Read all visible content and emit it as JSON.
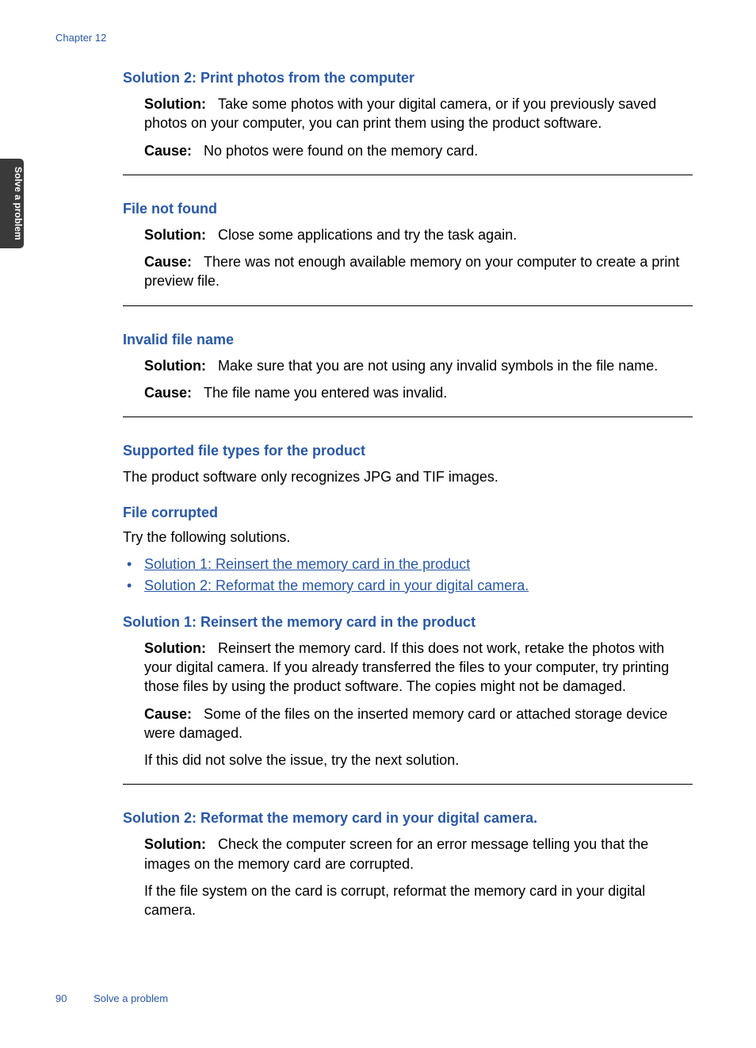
{
  "chapter": "Chapter 12",
  "sideTab": "Solve a problem",
  "sections": {
    "sol2print": {
      "heading": "Solution 2: Print photos from the computer",
      "solutionLabel": "Solution:",
      "solutionText": "Take some photos with your digital camera, or if you previously saved photos on your computer, you can print them using the product software.",
      "causeLabel": "Cause:",
      "causeText": "No photos were found on the memory card."
    },
    "fileNotFound": {
      "heading": "File not found",
      "solutionLabel": "Solution:",
      "solutionText": "Close some applications and try the task again.",
      "causeLabel": "Cause:",
      "causeText": "There was not enough available memory on your computer to create a print preview file."
    },
    "invalidFileName": {
      "heading": "Invalid file name",
      "solutionLabel": "Solution:",
      "solutionText": "Make sure that you are not using any invalid symbols in the file name.",
      "causeLabel": "Cause:",
      "causeText": "The file name you entered was invalid."
    },
    "supportedTypes": {
      "heading": "Supported file types for the product",
      "text": "The product software only recognizes JPG and TIF images."
    },
    "fileCorrupted": {
      "heading": "File corrupted",
      "tryText": "Try the following solutions.",
      "link1": "Solution 1: Reinsert the memory card in the product",
      "link2": "Solution 2: Reformat the memory card in your digital camera."
    },
    "sol1reinsert": {
      "heading": "Solution 1: Reinsert the memory card in the product",
      "solutionLabel": "Solution:",
      "solutionText": "Reinsert the memory card. If this does not work, retake the photos with your digital camera. If you already transferred the files to your computer, try printing those files by using the product software. The copies might not be damaged.",
      "causeLabel": "Cause:",
      "causeText": "Some of the files on the inserted memory card or attached storage device were damaged.",
      "nextText": "If this did not solve the issue, try the next solution."
    },
    "sol2reformat": {
      "heading": "Solution 2: Reformat the memory card in your digital camera.",
      "solutionLabel": "Solution:",
      "solutionText": "Check the computer screen for an error message telling you that the images on the memory card are corrupted.",
      "extraText": "If the file system on the card is corrupt, reformat the memory card in your digital camera."
    }
  },
  "footer": {
    "pageNum": "90",
    "text": "Solve a problem"
  }
}
